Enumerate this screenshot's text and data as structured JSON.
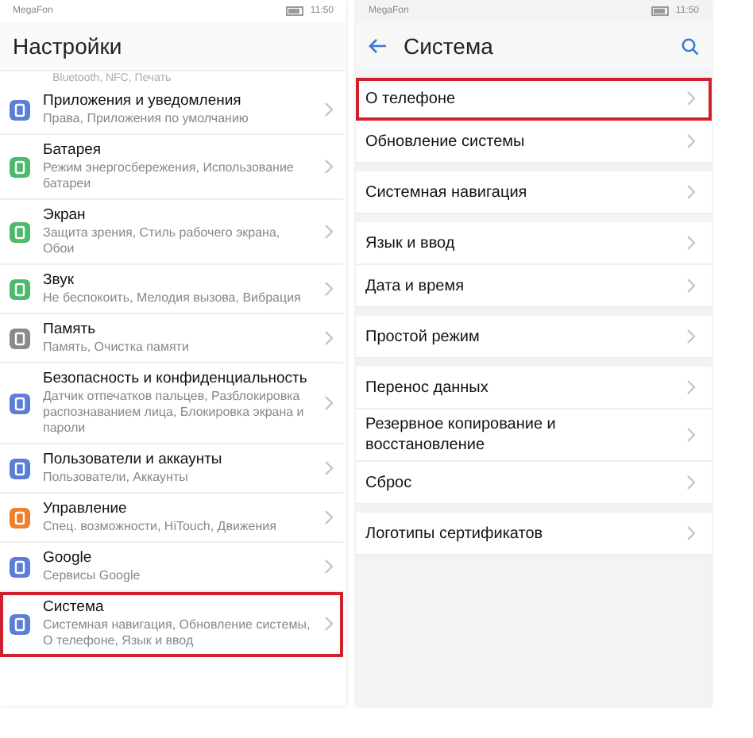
{
  "left": {
    "status_bar": {
      "carrier": "MegaFon",
      "time": "11:50"
    },
    "title": "Настройки",
    "cut_subtitle": "Bluetooth, NFC, Печать",
    "items": [
      {
        "title": "Приложения и уведомления",
        "subtitle": "Права, Приложения по умолчанию",
        "color": "#5b7fd6",
        "highlighted": false
      },
      {
        "title": "Батарея",
        "subtitle": "Режим энергосбережения, Использование батареи",
        "color": "#4cba6a",
        "highlighted": false
      },
      {
        "title": "Экран",
        "subtitle": "Защита зрения, Стиль рабочего экрана, Обои",
        "color": "#4cba6a",
        "highlighted": false
      },
      {
        "title": "Звук",
        "subtitle": "Не беспокоить, Мелодия вызова, Вибрация",
        "color": "#4cba6a",
        "highlighted": false
      },
      {
        "title": "Память",
        "subtitle": "Память, Очистка памяти",
        "color": "#8a8a8a",
        "highlighted": false
      },
      {
        "title": "Безопасность и конфиденциальность",
        "subtitle": "Датчик отпечатков пальцев, Разблокировка распознаванием лица, Блокировка экрана и пароли",
        "color": "#5b7fd6",
        "highlighted": false
      },
      {
        "title": "Пользователи и аккаунты",
        "subtitle": "Пользователи, Аккаунты",
        "color": "#5b7fd6",
        "highlighted": false
      },
      {
        "title": "Управление",
        "subtitle": "Спец. возможности, HiTouch, Движения",
        "color": "#f07f2b",
        "highlighted": false
      },
      {
        "title": "Google",
        "subtitle": "Сервисы Google",
        "color": "#5b7fd6",
        "highlighted": false
      },
      {
        "title": "Система",
        "subtitle": "Системная навигация, Обновление системы, О телефоне, Язык и ввод",
        "color": "#5b7fd6",
        "highlighted": true
      }
    ]
  },
  "right": {
    "status_bar": {
      "carrier": "MegaFon",
      "time": "11:50"
    },
    "title": "Система",
    "groups": [
      {
        "items": [
          {
            "title": "О телефоне",
            "highlighted": true
          },
          {
            "title": "Обновление системы",
            "highlighted": false
          }
        ]
      },
      {
        "items": [
          {
            "title": "Системная навигация",
            "highlighted": false
          }
        ]
      },
      {
        "items": [
          {
            "title": "Язык и ввод",
            "highlighted": false
          },
          {
            "title": "Дата и время",
            "highlighted": false
          }
        ]
      },
      {
        "items": [
          {
            "title": "Простой режим",
            "highlighted": false
          }
        ]
      },
      {
        "items": [
          {
            "title": "Перенос данных",
            "highlighted": false
          },
          {
            "title": "Резервное копирование и восстановление",
            "highlighted": false
          },
          {
            "title": "Сброс",
            "highlighted": false
          }
        ]
      },
      {
        "items": [
          {
            "title": "Логотипы сертификатов",
            "highlighted": false
          }
        ]
      }
    ]
  }
}
